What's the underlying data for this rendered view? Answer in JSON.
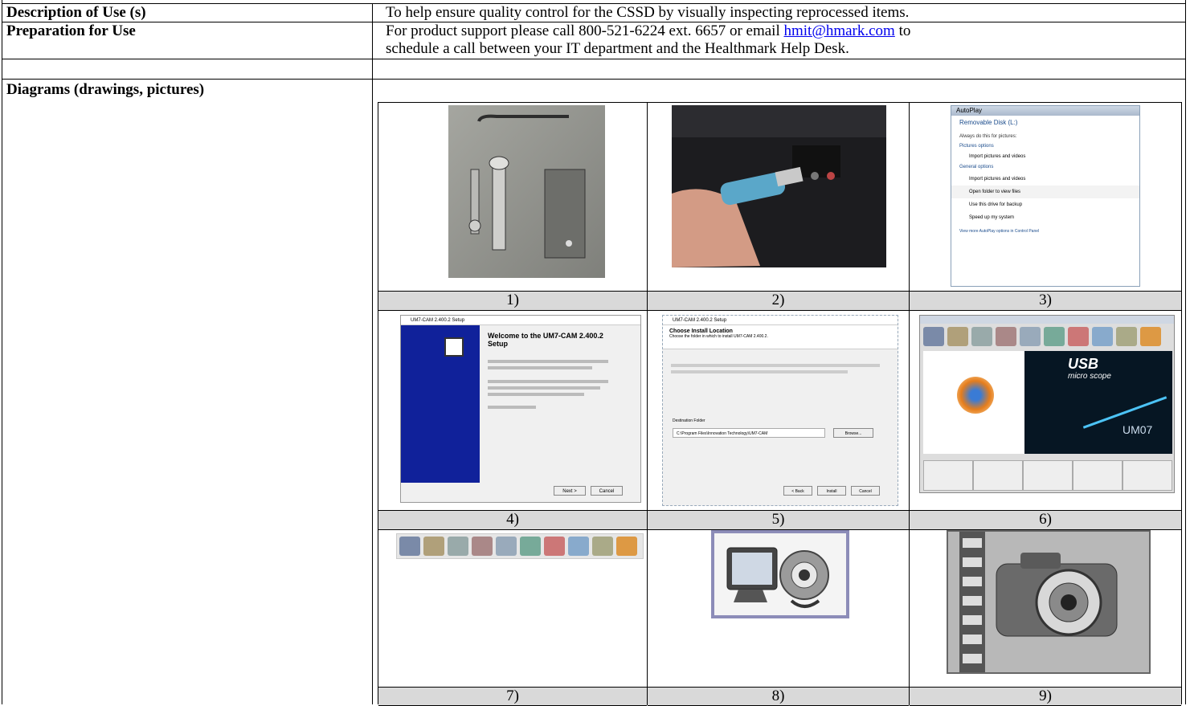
{
  "rows": [
    {
      "label": "Description of Use (s)",
      "value": "To help ensure quality control for the CSSD by visually inspecting reprocessed items."
    },
    {
      "label": "Preparation for Use",
      "value_line1_prefix": "For product support please call 800-521-6224 ext. 6657 or email ",
      "value_link": "hmit@hmark.com",
      "value_line1_suffix": " to",
      "value_line2": "schedule a call between your IT department and the Healthmark Help Desk."
    },
    {
      "label": "Diagrams (drawings, pictures)"
    }
  ],
  "captions": [
    "1)",
    "2)",
    "3)",
    "4)",
    "5)",
    "6)",
    "7)",
    "8)",
    "9)"
  ],
  "screens": {
    "autoplay_title": "AutoPlay",
    "autoplay_disk": "Removable Disk (L:)",
    "autoplay_always": "Always do this for pictures:",
    "autoplay_pictures_header": "Pictures options",
    "autoplay_general_header": "General options",
    "autoplay_items": [
      "Import pictures and videos",
      "Import pictures and videos",
      "Open folder to view files",
      "Use this drive for backup",
      "Speed up my system"
    ],
    "autoplay_footer": "View more AutoPlay options in Control Panel",
    "setup_title": "UM7-CAM 2.400.2 Setup",
    "setup_welcome": "Welcome to the UM7-CAM 2.400.2 Setup",
    "setup_next": "Next >",
    "setup_cancel": "Cancel",
    "install_title": "UM7-CAM 2.400.2 Setup",
    "install_heading": "Choose Install Location",
    "install_sub": "Choose the folder in which to install UM7-CAM 2.400.2.",
    "install_dest": "Destination Folder",
    "install_path": "C:\\Program Files\\Innovation Technology\\UM7-CAM",
    "install_browse": "Browse...",
    "install_back": "< Back",
    "install_install": "Install",
    "install_cancel": "Cancel",
    "app_brand_usb": "USB",
    "app_brand_micro": "micro scope",
    "app_brand_um": "UM07"
  }
}
